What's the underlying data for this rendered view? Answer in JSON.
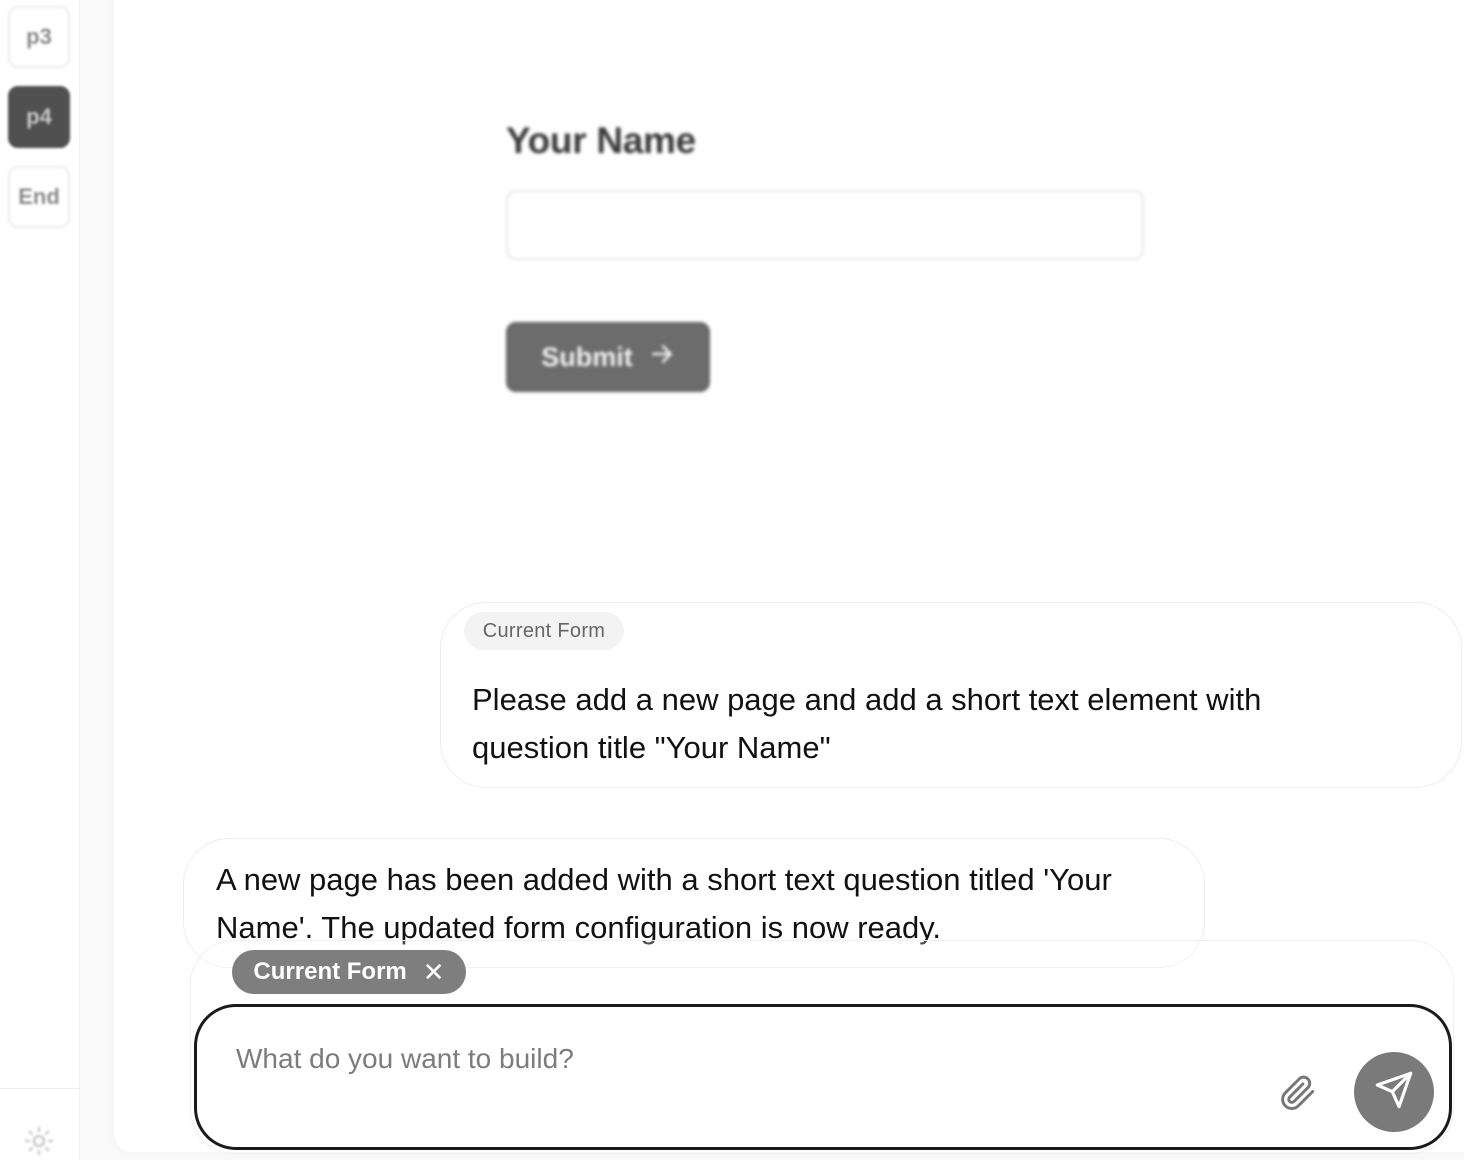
{
  "pages": [
    {
      "label": "p3",
      "active": false
    },
    {
      "label": "p4",
      "active": true
    },
    {
      "label": "End",
      "active": false
    }
  ],
  "preview": {
    "question_title": "Your Name",
    "submit_label": "Submit",
    "submit_icon": "arrow-right-icon"
  },
  "chat": {
    "user_message": {
      "context_chip": "Current Form",
      "text": "Please add a new page and add a short text element with question title \"Your Name\""
    },
    "assistant_message": {
      "text": "A new page has been added with a short text question titled 'Your Name'. The updated form configuration is now ready."
    }
  },
  "composer": {
    "context_tag": "Current Form",
    "remove_icon": "close-icon",
    "placeholder": "What do you want to build?",
    "value": "",
    "attach_icon": "paperclip-icon",
    "send_icon": "send-icon"
  },
  "theme_icon": "sun-icon",
  "colors": {
    "active_page": "#505050",
    "submit_button": "#6c6c6c",
    "context_tag": "#7e7e7e",
    "send_button": "#7a7a7a",
    "composer_border": "#1b1b1b"
  }
}
